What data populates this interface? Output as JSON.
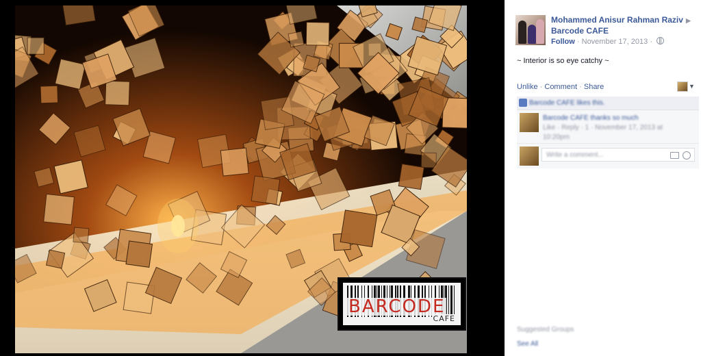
{
  "photo": {
    "brand_logo": {
      "brand": "BARCODE",
      "sub": "CAFE"
    }
  },
  "post": {
    "author": "Mohammed Anisur Rahman Raziv",
    "page": "Barcode CAFE",
    "follow_label": "Follow",
    "date": "November 17, 2013",
    "caption": "~ Interior is so eye catchy ~",
    "actions": [
      "Unlike",
      "Comment",
      "Share"
    ],
    "likes_text": "Barcode CAFE likes this.",
    "comment": {
      "text": "Barcode CAFE thanks so much",
      "meta": "Like · Reply · 1 · November 17, 2013 at",
      "time": "10:20pm"
    },
    "write_placeholder": "Write a comment...",
    "suggested_label": "Suggested Groups",
    "see_all_label": "See All"
  },
  "colors": {
    "link": "#3b5998",
    "meta": "#9197a3",
    "panel_bg": "#ffffff"
  }
}
